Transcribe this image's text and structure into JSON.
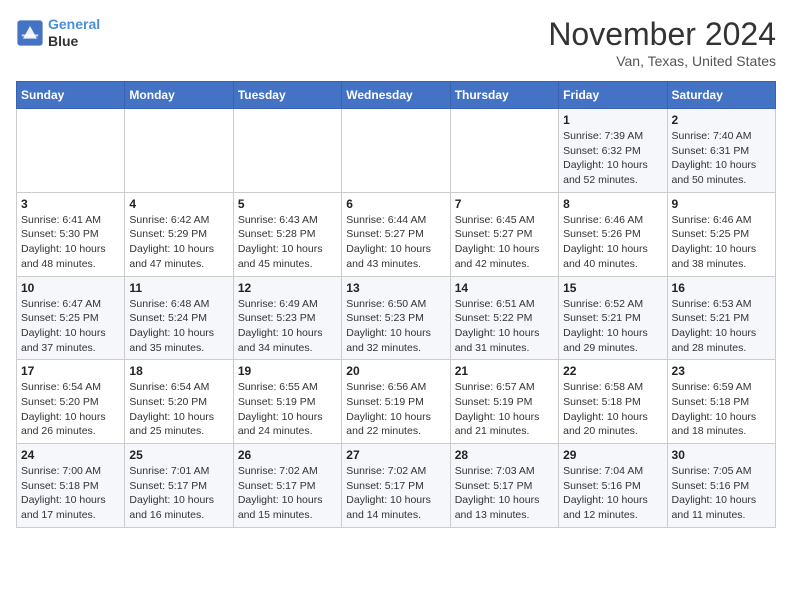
{
  "header": {
    "logo_line1": "General",
    "logo_line2": "Blue",
    "month": "November 2024",
    "location": "Van, Texas, United States"
  },
  "weekdays": [
    "Sunday",
    "Monday",
    "Tuesday",
    "Wednesday",
    "Thursday",
    "Friday",
    "Saturday"
  ],
  "weeks": [
    [
      {
        "day": "",
        "info": ""
      },
      {
        "day": "",
        "info": ""
      },
      {
        "day": "",
        "info": ""
      },
      {
        "day": "",
        "info": ""
      },
      {
        "day": "",
        "info": ""
      },
      {
        "day": "1",
        "info": "Sunrise: 7:39 AM\nSunset: 6:32 PM\nDaylight: 10 hours\nand 52 minutes."
      },
      {
        "day": "2",
        "info": "Sunrise: 7:40 AM\nSunset: 6:31 PM\nDaylight: 10 hours\nand 50 minutes."
      }
    ],
    [
      {
        "day": "3",
        "info": "Sunrise: 6:41 AM\nSunset: 5:30 PM\nDaylight: 10 hours\nand 48 minutes."
      },
      {
        "day": "4",
        "info": "Sunrise: 6:42 AM\nSunset: 5:29 PM\nDaylight: 10 hours\nand 47 minutes."
      },
      {
        "day": "5",
        "info": "Sunrise: 6:43 AM\nSunset: 5:28 PM\nDaylight: 10 hours\nand 45 minutes."
      },
      {
        "day": "6",
        "info": "Sunrise: 6:44 AM\nSunset: 5:27 PM\nDaylight: 10 hours\nand 43 minutes."
      },
      {
        "day": "7",
        "info": "Sunrise: 6:45 AM\nSunset: 5:27 PM\nDaylight: 10 hours\nand 42 minutes."
      },
      {
        "day": "8",
        "info": "Sunrise: 6:46 AM\nSunset: 5:26 PM\nDaylight: 10 hours\nand 40 minutes."
      },
      {
        "day": "9",
        "info": "Sunrise: 6:46 AM\nSunset: 5:25 PM\nDaylight: 10 hours\nand 38 minutes."
      }
    ],
    [
      {
        "day": "10",
        "info": "Sunrise: 6:47 AM\nSunset: 5:25 PM\nDaylight: 10 hours\nand 37 minutes."
      },
      {
        "day": "11",
        "info": "Sunrise: 6:48 AM\nSunset: 5:24 PM\nDaylight: 10 hours\nand 35 minutes."
      },
      {
        "day": "12",
        "info": "Sunrise: 6:49 AM\nSunset: 5:23 PM\nDaylight: 10 hours\nand 34 minutes."
      },
      {
        "day": "13",
        "info": "Sunrise: 6:50 AM\nSunset: 5:23 PM\nDaylight: 10 hours\nand 32 minutes."
      },
      {
        "day": "14",
        "info": "Sunrise: 6:51 AM\nSunset: 5:22 PM\nDaylight: 10 hours\nand 31 minutes."
      },
      {
        "day": "15",
        "info": "Sunrise: 6:52 AM\nSunset: 5:21 PM\nDaylight: 10 hours\nand 29 minutes."
      },
      {
        "day": "16",
        "info": "Sunrise: 6:53 AM\nSunset: 5:21 PM\nDaylight: 10 hours\nand 28 minutes."
      }
    ],
    [
      {
        "day": "17",
        "info": "Sunrise: 6:54 AM\nSunset: 5:20 PM\nDaylight: 10 hours\nand 26 minutes."
      },
      {
        "day": "18",
        "info": "Sunrise: 6:54 AM\nSunset: 5:20 PM\nDaylight: 10 hours\nand 25 minutes."
      },
      {
        "day": "19",
        "info": "Sunrise: 6:55 AM\nSunset: 5:19 PM\nDaylight: 10 hours\nand 24 minutes."
      },
      {
        "day": "20",
        "info": "Sunrise: 6:56 AM\nSunset: 5:19 PM\nDaylight: 10 hours\nand 22 minutes."
      },
      {
        "day": "21",
        "info": "Sunrise: 6:57 AM\nSunset: 5:19 PM\nDaylight: 10 hours\nand 21 minutes."
      },
      {
        "day": "22",
        "info": "Sunrise: 6:58 AM\nSunset: 5:18 PM\nDaylight: 10 hours\nand 20 minutes."
      },
      {
        "day": "23",
        "info": "Sunrise: 6:59 AM\nSunset: 5:18 PM\nDaylight: 10 hours\nand 18 minutes."
      }
    ],
    [
      {
        "day": "24",
        "info": "Sunrise: 7:00 AM\nSunset: 5:18 PM\nDaylight: 10 hours\nand 17 minutes."
      },
      {
        "day": "25",
        "info": "Sunrise: 7:01 AM\nSunset: 5:17 PM\nDaylight: 10 hours\nand 16 minutes."
      },
      {
        "day": "26",
        "info": "Sunrise: 7:02 AM\nSunset: 5:17 PM\nDaylight: 10 hours\nand 15 minutes."
      },
      {
        "day": "27",
        "info": "Sunrise: 7:02 AM\nSunset: 5:17 PM\nDaylight: 10 hours\nand 14 minutes."
      },
      {
        "day": "28",
        "info": "Sunrise: 7:03 AM\nSunset: 5:17 PM\nDaylight: 10 hours\nand 13 minutes."
      },
      {
        "day": "29",
        "info": "Sunrise: 7:04 AM\nSunset: 5:16 PM\nDaylight: 10 hours\nand 12 minutes."
      },
      {
        "day": "30",
        "info": "Sunrise: 7:05 AM\nSunset: 5:16 PM\nDaylight: 10 hours\nand 11 minutes."
      }
    ]
  ]
}
